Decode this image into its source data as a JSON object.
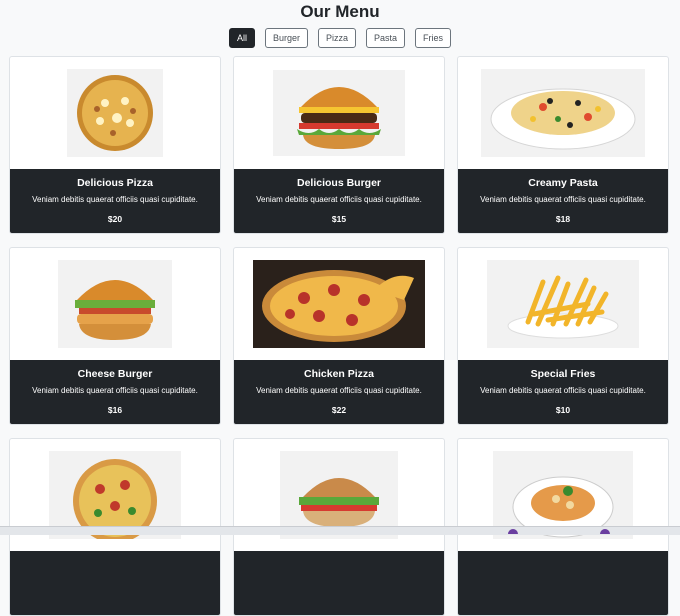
{
  "page": {
    "title": "Our Menu"
  },
  "filters": [
    {
      "label": "All",
      "active": true
    },
    {
      "label": "Burger",
      "active": false
    },
    {
      "label": "Pizza",
      "active": false
    },
    {
      "label": "Pasta",
      "active": false
    },
    {
      "label": "Fries",
      "active": false
    }
  ],
  "items": [
    {
      "title": "Delicious Pizza",
      "description": "Veniam debitis quaerat officiis quasi cupiditate.",
      "price": "$20",
      "image": "pizza-image"
    },
    {
      "title": "Delicious Burger",
      "description": "Veniam debitis quaerat officiis quasi cupiditate.",
      "price": "$15",
      "image": "burger-image"
    },
    {
      "title": "Creamy Pasta",
      "description": "Veniam debitis quaerat officiis quasi cupiditate.",
      "price": "$18",
      "image": "pasta-image"
    },
    {
      "title": "Cheese Burger",
      "description": "Veniam debitis quaerat officiis quasi cupiditate.",
      "price": "$16",
      "image": "burger-image"
    },
    {
      "title": "Chicken Pizza",
      "description": "Veniam debitis quaerat officiis quasi cupiditate.",
      "price": "$22",
      "image": "pizza-image"
    },
    {
      "title": "Special Fries",
      "description": "Veniam debitis quaerat officiis quasi cupiditate.",
      "price": "$10",
      "image": "fries-image"
    },
    {
      "title": "",
      "description": "",
      "price": "",
      "image": "pizza-image"
    },
    {
      "title": "",
      "description": "",
      "price": "",
      "image": "burger-image"
    },
    {
      "title": "",
      "description": "",
      "price": "",
      "image": "pasta-image"
    }
  ],
  "colors": {
    "card_footer": "#212529",
    "active_filter": "#212529",
    "background": "#f8f9fa"
  }
}
